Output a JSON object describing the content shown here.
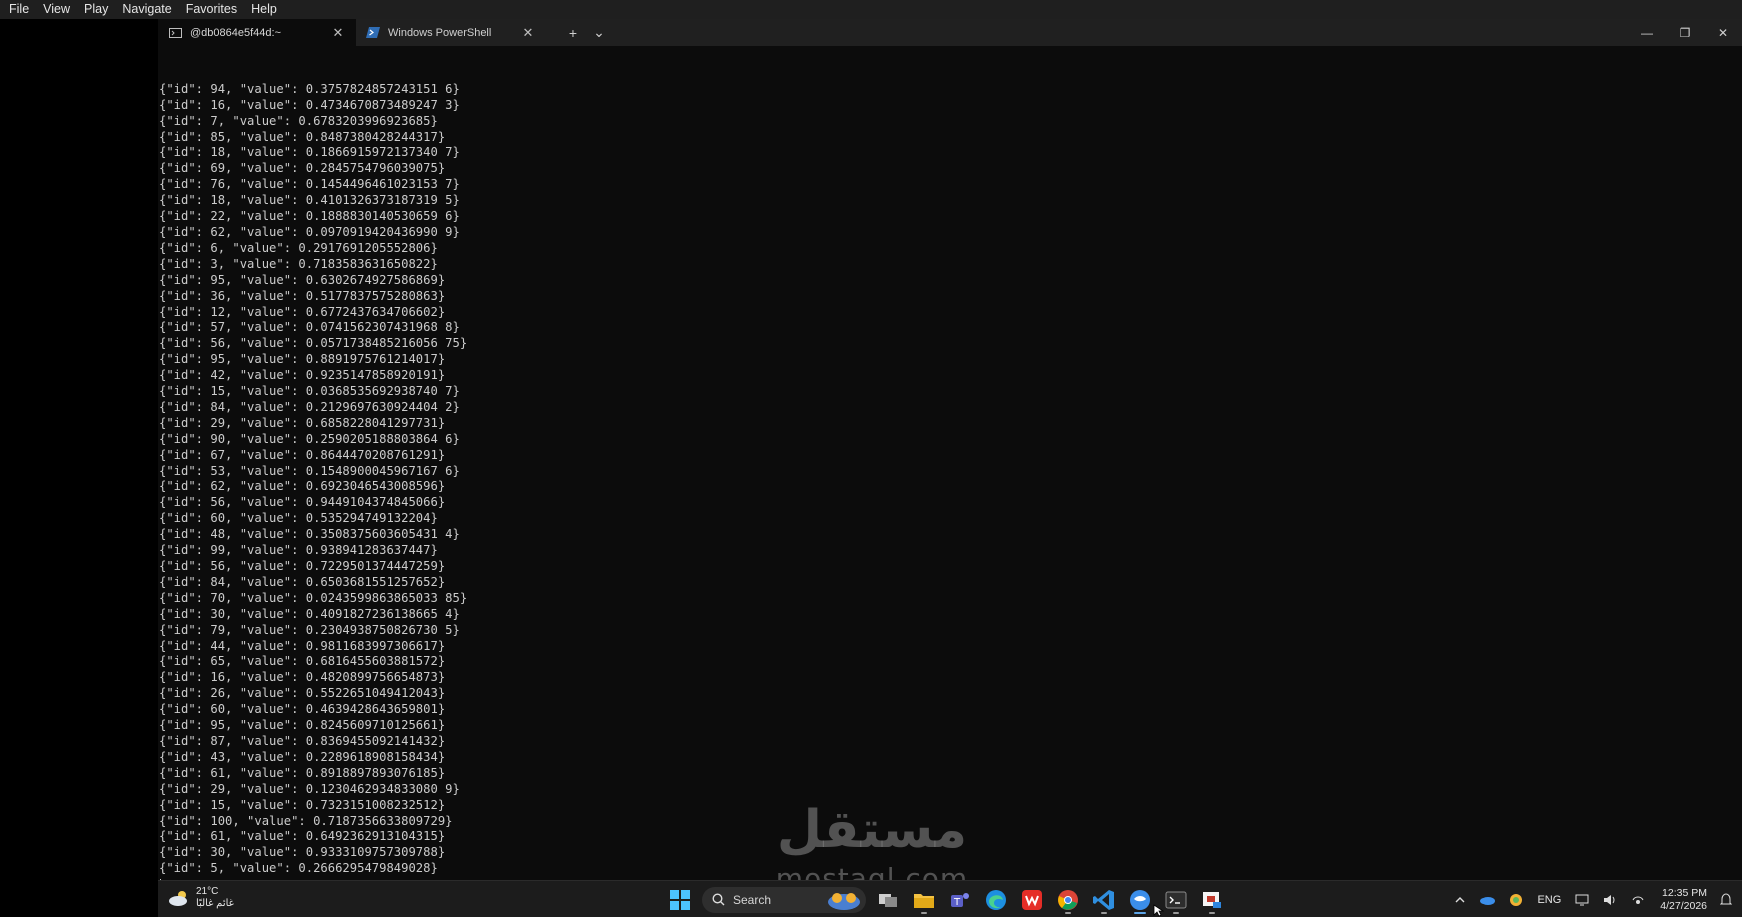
{
  "menubar": {
    "items": [
      "File",
      "View",
      "Play",
      "Navigate",
      "Favorites",
      "Help"
    ]
  },
  "tabs": [
    {
      "label": "@db0864e5f44d:~",
      "icon": "terminal-icon",
      "active": true
    },
    {
      "label": "Windows PowerShell",
      "icon": "powershell-icon",
      "active": false
    }
  ],
  "tab_actions": {
    "new_tab": "+",
    "dropdown": "⌄"
  },
  "window_controls": {
    "minimize": "—",
    "restore": "❐",
    "close": "✕"
  },
  "console_lines": [
    "{\"id\": 94, \"value\": 0.3757824857243151 6}",
    "{\"id\": 16, \"value\": 0.4734670873489247 3}",
    "{\"id\": 7, \"value\": 0.6783203996923685}",
    "{\"id\": 85, \"value\": 0.8487380428244317}",
    "{\"id\": 18, \"value\": 0.1866915972137340 7}",
    "{\"id\": 69, \"value\": 0.2845754796039075}",
    "{\"id\": 76, \"value\": 0.1454496461023153 7}",
    "{\"id\": 18, \"value\": 0.4101326373187319 5}",
    "{\"id\": 22, \"value\": 0.1888830140530659 6}",
    "{\"id\": 62, \"value\": 0.0970919420436990 9}",
    "{\"id\": 6, \"value\": 0.2917691205552806}",
    "{\"id\": 3, \"value\": 0.7183583631650822}",
    "{\"id\": 95, \"value\": 0.6302674927586869}",
    "{\"id\": 36, \"value\": 0.5177837575280863}",
    "{\"id\": 12, \"value\": 0.6772437634706602}",
    "{\"id\": 57, \"value\": 0.0741562307431968 8}",
    "{\"id\": 56, \"value\": 0.0571738485216056 75}",
    "{\"id\": 95, \"value\": 0.8891975761214017}",
    "{\"id\": 42, \"value\": 0.9235147858920191}",
    "{\"id\": 15, \"value\": 0.0368535692938740 7}",
    "{\"id\": 84, \"value\": 0.2129697630924404 2}",
    "{\"id\": 29, \"value\": 0.6858228041297731}",
    "{\"id\": 90, \"value\": 0.2590205188803864 6}",
    "{\"id\": 67, \"value\": 0.8644470208761291}",
    "{\"id\": 53, \"value\": 0.1548900045967167 6}",
    "{\"id\": 62, \"value\": 0.6923046543008596}",
    "{\"id\": 56, \"value\": 0.9449104374845066}",
    "{\"id\": 60, \"value\": 0.535294749132204}",
    "{\"id\": 48, \"value\": 0.3508375603605431 4}",
    "{\"id\": 99, \"value\": 0.938941283637447}",
    "{\"id\": 56, \"value\": 0.7229501374447259}",
    "{\"id\": 84, \"value\": 0.6503681551257652}",
    "{\"id\": 70, \"value\": 0.0243599863865033 85}",
    "{\"id\": 30, \"value\": 0.4091827236138665 4}",
    "{\"id\": 79, \"value\": 0.2304938750826730 5}",
    "{\"id\": 44, \"value\": 0.9811683997306617}",
    "{\"id\": 65, \"value\": 0.6816455603881572}",
    "{\"id\": 16, \"value\": 0.4820899756654873}",
    "{\"id\": 26, \"value\": 0.5522651049412043}",
    "{\"id\": 60, \"value\": 0.4639428643659801}",
    "{\"id\": 95, \"value\": 0.8245609710125661}",
    "{\"id\": 87, \"value\": 0.8369455092141432}",
    "{\"id\": 43, \"value\": 0.2289618908158434}",
    "{\"id\": 61, \"value\": 0.8918897893076185}",
    "{\"id\": 29, \"value\": 0.1230462934833080 9}",
    "{\"id\": 15, \"value\": 0.7323151008232512}",
    "{\"id\": 100, \"value\": 0.7187356633809729}",
    "{\"id\": 61, \"value\": 0.6492362913104315}",
    "{\"id\": 30, \"value\": 0.9333109757309788}",
    "{\"id\": 5, \"value\": 0.2666295479849028}"
  ],
  "watermark": {
    "arabic": "مستقل",
    "latin": "mostaql.com"
  },
  "taskbar": {
    "weather": {
      "temp": "21°C",
      "desc": "غائم غالبًا"
    },
    "search_label": "Search",
    "pinned": [
      "windows-start-icon",
      "widgets-icon",
      "task-view-icon",
      "file-explorer-icon",
      "teams-icon",
      "edge-icon",
      "wps-office-icon",
      "chrome-icon",
      "vscode-icon",
      "app-blue-icon",
      "terminal-app-icon",
      "snipping-icon"
    ],
    "tray": {
      "language": "ENG",
      "time": "12:35 PM",
      "date": "4/27/2026"
    }
  },
  "colors": {
    "terminal_bg": "#0c0c0c",
    "text": "#cccccc",
    "tabbar_bg": "#202020",
    "taskbar_bg": "#1c1c1c",
    "accent": "#5ea6e8"
  }
}
